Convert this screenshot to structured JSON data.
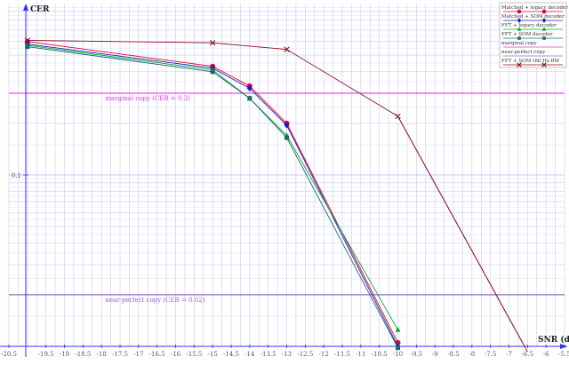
{
  "chart_data": {
    "type": "line",
    "xlabel": "SNR (dB)",
    "ylabel": "CER",
    "x_scale": "linear",
    "y_scale": "log",
    "xlim": [
      -20.5,
      -5.5
    ],
    "ylim": [
      0.01,
      1.0
    ],
    "grid": true,
    "legend_position": "top-right",
    "x_ticks": [
      -20.5,
      -19.5,
      -19,
      -18.5,
      -18,
      -17.5,
      -17,
      -16.5,
      -16,
      -15.5,
      -15,
      -14.5,
      -14,
      -13.5,
      -13,
      -12.5,
      -12,
      -11.5,
      -11,
      -10.5,
      -10,
      -9.5,
      -9,
      -8.5,
      -8,
      -7.5,
      -7,
      -6.5,
      -6,
      -5.5
    ],
    "x_tick_labels": [
      "-20.5",
      "-19.5",
      "-19",
      "-18.5",
      "-18",
      "-17.5",
      "-17",
      "-16.5",
      "-16",
      "-15.5",
      "-15",
      "-14.5",
      "-14",
      "-13.5",
      "-13",
      "-12.5",
      "-12",
      "-11.5",
      "-11",
      "-10.5",
      "-10",
      "-9.5",
      "-9",
      "-8.5",
      "-8",
      "-7.5",
      "-7",
      "-6.5",
      "-6",
      "-5.5"
    ],
    "y_tick_labels": [
      {
        "value": 0.1,
        "label": "0.1"
      }
    ],
    "series": [
      {
        "name": "Matched + legacy decoder",
        "color": "#e8002a",
        "marker": "circle",
        "x": [
          -20,
          -15,
          -14,
          -13,
          -10
        ],
        "y": [
          0.6,
          0.43,
          0.33,
          0.2,
          0.0105
        ]
      },
      {
        "name": "Matched + SOM decoder",
        "color": "#1020c8",
        "marker": "diamond",
        "x": [
          -20,
          -15,
          -14,
          -13,
          -10
        ],
        "y": [
          0.58,
          0.42,
          0.32,
          0.195,
          0.01
        ]
      },
      {
        "name": "FFT + legacy decoder",
        "color": "#10a830",
        "marker": "triangle",
        "x": [
          -20,
          -15,
          -14,
          -13,
          -10
        ],
        "y": [
          0.57,
          0.41,
          0.28,
          0.17,
          0.0125
        ]
      },
      {
        "name": "FFT + SOM decoder",
        "color": "#1a6a6a",
        "marker": "square",
        "x": [
          -20,
          -15,
          -14,
          -13,
          -10
        ],
        "y": [
          0.56,
          0.4,
          0.28,
          0.165,
          0.0098
        ]
      },
      {
        "name": "FFT + SOM (fill Hz BW",
        "color": "#8a1020",
        "marker": "x",
        "x": [
          -20,
          -15,
          -13,
          -10,
          -6.5
        ],
        "y": [
          0.61,
          0.59,
          0.54,
          0.22,
          0.0093
        ]
      }
    ],
    "reference_lines": [
      {
        "name": "marginal copy",
        "label": "marginal copy (CER = 0.3)",
        "y": 0.3,
        "color": "#ee33ee"
      },
      {
        "name": "near-perfect copy",
        "label": "near-perfect copy (CER = 0.02)",
        "y": 0.02,
        "color": "#9966cc"
      }
    ],
    "legend_entries": [
      {
        "label": "Matched + legacy decoder",
        "color": "#e8002a",
        "marker": "circle"
      },
      {
        "label": "Matched + SOM decoder",
        "color": "#1020c8",
        "marker": "diamond"
      },
      {
        "label": "FFT + legacy decoder",
        "color": "#10a830",
        "marker": "triangle"
      },
      {
        "label": "FFT + SOM decoder",
        "color": "#1a6a6a",
        "marker": "square"
      },
      {
        "label": "marginal copy",
        "color": "#ee33ee",
        "marker": "none"
      },
      {
        "label": "near-perfect copy",
        "color": "#9966cc",
        "marker": "none"
      },
      {
        "label": "FFT + SOM (fill Hz BW",
        "color": "#8a1020",
        "marker": "x"
      }
    ],
    "colors": {
      "background": "#ffffff",
      "grid": "#c8c8ff",
      "axis": "#3030ff"
    }
  }
}
